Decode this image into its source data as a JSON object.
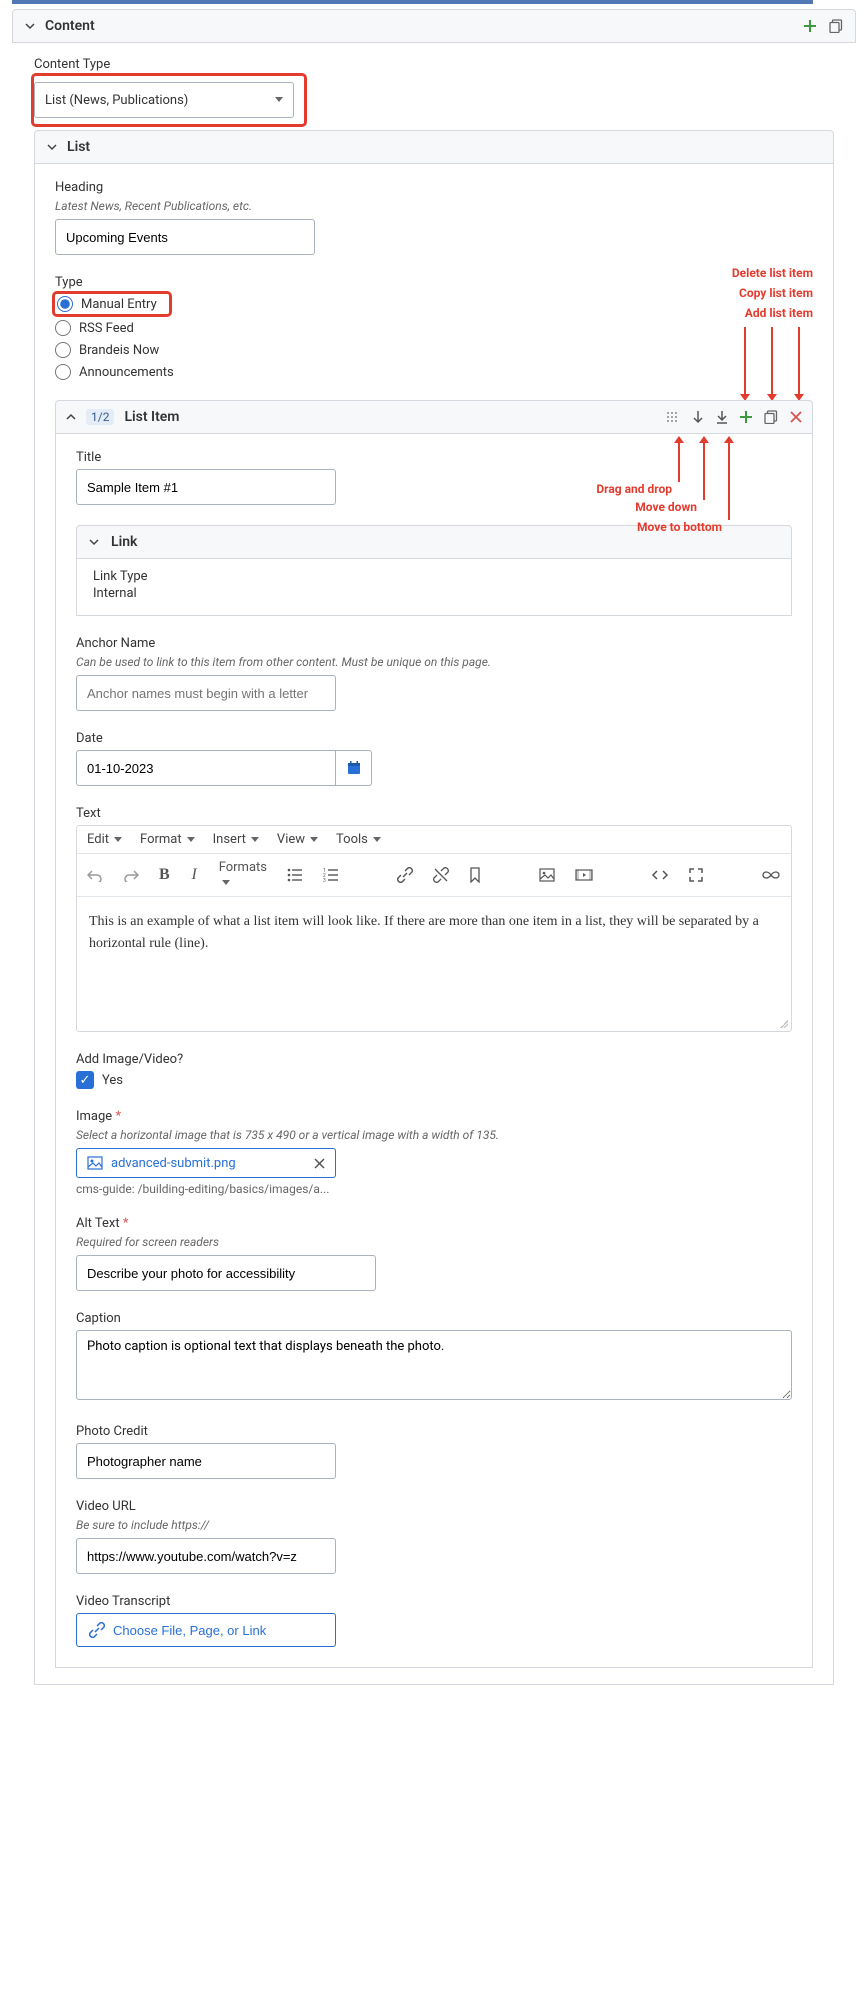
{
  "content": {
    "panel_title": "Content",
    "content_type_label": "Content Type",
    "content_type_value": "List (News, Publications)"
  },
  "list": {
    "panel_title": "List",
    "heading_label": "Heading",
    "heading_hint": "Latest News, Recent Publications, etc.",
    "heading_value": "Upcoming Events",
    "type_label": "Type",
    "type_options": {
      "manual": "Manual Entry",
      "rss": "RSS Feed",
      "brandeis": "Brandeis Now",
      "announcements": "Announcements"
    }
  },
  "annotations": {
    "delete": "Delete list item",
    "copy": "Copy list item",
    "add": "Add list item",
    "drag": "Drag and drop",
    "move_down": "Move down",
    "move_bottom": "Move to bottom"
  },
  "list_item": {
    "count": "1/2",
    "title": "List Item",
    "title_label": "Title",
    "title_value": "Sample Item #1",
    "link_panel_title": "Link",
    "link_type_label": "Link Type",
    "link_type_value": "Internal",
    "anchor_label": "Anchor Name",
    "anchor_hint": "Can be used to link to this item from other content. Must be unique on this page.",
    "anchor_placeholder": "Anchor names must begin with a letter",
    "date_label": "Date",
    "date_value": "01-10-2023",
    "text_label": "Text",
    "rte_menus": {
      "edit": "Edit",
      "format": "Format",
      "insert": "Insert",
      "view": "View",
      "tools": "Tools"
    },
    "rte_formats": "Formats",
    "rte_body": "This is an example of what a list item will look like. If there are more than one item in a list, they will be separated by a horizontal rule (line).",
    "add_image_label": "Add Image/Video?",
    "add_image_yes": "Yes",
    "image_label": "Image",
    "image_hint": "Select a horizontal image that is 735 x 490 or a vertical image with a width of 135.",
    "image_file": "advanced-submit.png",
    "image_path": "cms-guide: /building-editing/basics/images/a...",
    "alt_label": "Alt Text",
    "alt_hint": "Required for screen readers",
    "alt_value": "Describe your photo for accessibility",
    "caption_label": "Caption",
    "caption_value": "Photo caption is optional text that displays beneath the photo.",
    "credit_label": "Photo Credit",
    "credit_value": "Photographer name",
    "video_url_label": "Video URL",
    "video_url_hint": "Be sure to include https://",
    "video_url_value": "https://www.youtube.com/watch?v=z",
    "transcript_label": "Video Transcript",
    "transcript_button": "Choose File, Page, or Link"
  }
}
